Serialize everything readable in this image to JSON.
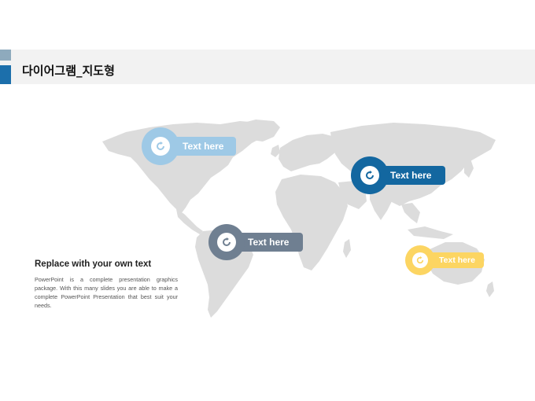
{
  "header": {
    "title": "다이어그램_지도형"
  },
  "pins": {
    "north_america": {
      "label": "Text here",
      "color": "#9ec9e6"
    },
    "asia": {
      "label": "Text here",
      "color": "#1367a0"
    },
    "south_america": {
      "label": "Text here",
      "color": "#6f7f91"
    },
    "australia": {
      "label": "Text here",
      "color": "#fcd562"
    }
  },
  "description": {
    "title": "Replace with your own text",
    "body": "PowerPoint is a complete presentation graphics package. With this many slides you are able to make a complete PowerPoint Presentation that best suit your needs."
  },
  "icons": {
    "pin_icon": "refresh-icon",
    "map": "world-map"
  }
}
